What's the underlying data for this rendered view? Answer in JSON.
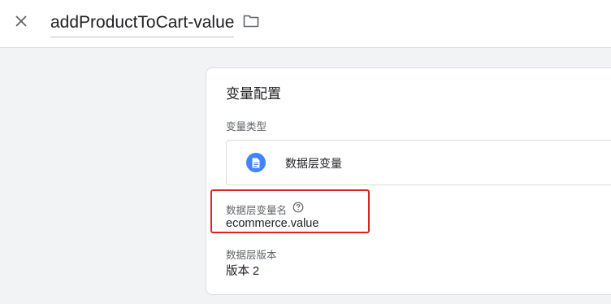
{
  "header": {
    "title": "addProductToCart-value",
    "close_icon": "close-icon",
    "folder_icon": "folder-icon"
  },
  "card": {
    "title": "变量配置",
    "variable_type": {
      "label": "变量类型",
      "value": "数据层变量",
      "icon": "document-icon",
      "icon_color": "#4285f4"
    },
    "dl_variable_name": {
      "label": "数据层变量名",
      "value": "ecommerce.value",
      "help_icon": "help-circle-icon"
    },
    "dl_version": {
      "label": "数据层版本",
      "value": "版本 2"
    }
  },
  "colors": {
    "highlight_border": "#e02020",
    "background": "#f1f3f4"
  }
}
